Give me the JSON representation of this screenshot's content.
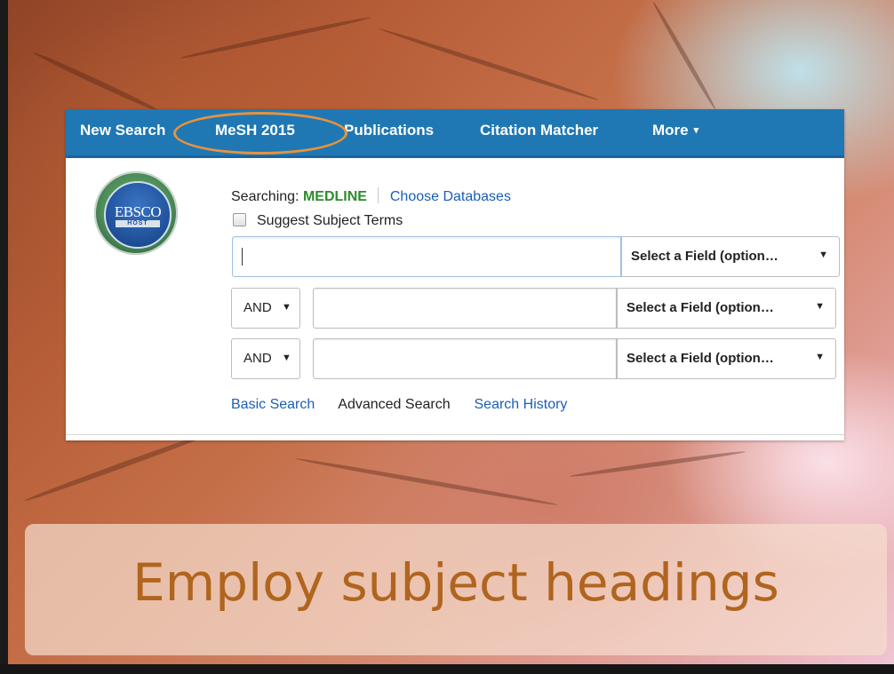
{
  "nav": {
    "items": [
      "New Search",
      "MeSH 2015",
      "Publications",
      "Citation Matcher",
      "More"
    ],
    "more_caret": "▾",
    "highlighted": "MeSH 2015",
    "bg_color": "#1f78b4",
    "highlight_color": "#e8933b"
  },
  "logo": {
    "text": "EBSCO",
    "subtext": "HOST"
  },
  "search": {
    "searching_label": "Searching:",
    "database": "MEDLINE",
    "choose_databases": "Choose Databases",
    "suggest_label": "Suggest Subject Terms",
    "suggest_checked": false,
    "rows": [
      {
        "boolean": "",
        "value": "",
        "field": "Select a Field (option…"
      },
      {
        "boolean": "AND",
        "value": "",
        "field": "Select a Field (option…"
      },
      {
        "boolean": "AND",
        "value": "",
        "field": "Select a Field (option…"
      }
    ]
  },
  "links": {
    "basic": "Basic Search",
    "advanced": "Advanced Search",
    "history": "Search History"
  },
  "caption": {
    "text": "Employ subject headings",
    "color": "#b0651f"
  }
}
